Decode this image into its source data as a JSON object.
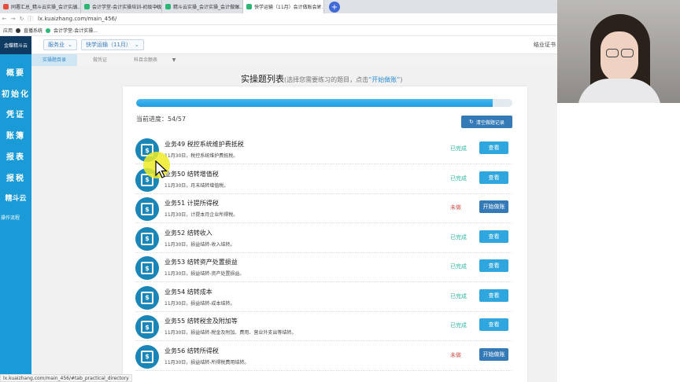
{
  "browser": {
    "tabs": [
      {
        "label": "同署汇总_精斗云实操_会计实战..."
      },
      {
        "label": "会计学堂-会计实操培训-初级中级..."
      },
      {
        "label": "精斗云实操_会计实操_会计做账..."
      },
      {
        "label": "快学运输（11月）会计做账会计..."
      }
    ],
    "new_tab": "+",
    "url": "lx.kuaizhang.com/main_456/",
    "bookmarks": [
      "应用",
      "直播系统",
      "会计学堂-会计实操..."
    ]
  },
  "app": {
    "logo": "金蝶精斗云",
    "service_select": "服务业",
    "company_select": "快学运输（11月）",
    "certificate": "结业证书"
  },
  "subnav": {
    "tabs": [
      "实操题目录",
      "做凭证",
      "科目余额表"
    ]
  },
  "sidebar": {
    "items": [
      "概要",
      "初始化",
      "凭证",
      "账簿",
      "报表",
      "报税",
      "精斗云",
      "操作流程"
    ]
  },
  "page": {
    "title": "实操题列表",
    "subtitle_prefix": "(选择您需要练习的题目，点击",
    "subtitle_highlight": "“开始做账”",
    "subtitle_suffix": ")",
    "progress_label": "当前进度：54/57",
    "progress_fraction": 0.947,
    "clear_button": "清空做题记录",
    "rows": [
      {
        "title": "业务49 税控系统维护费抵税",
        "desc": "11月30日，税控系统维护费抵税。",
        "status": "已完成",
        "status_type": "done",
        "button": "查看",
        "button_type": "view"
      },
      {
        "title": "业务50 结转增值税",
        "desc": "11月30日，月末结转增值税。",
        "status": "已完成",
        "status_type": "done",
        "button": "查看",
        "button_type": "view"
      },
      {
        "title": "业务51 计提所得税",
        "desc": "11月30日，计提本月企业所得税。",
        "status": "未做",
        "status_type": "todo",
        "button": "开始做账",
        "button_type": "start"
      },
      {
        "title": "业务52 结转收入",
        "desc": "11月30日，损益结转-收入结转。",
        "status": "已完成",
        "status_type": "done",
        "button": "查看",
        "button_type": "view"
      },
      {
        "title": "业务53 结转资产处置损益",
        "desc": "11月30日，损益结转-资产处置损益。",
        "status": "已完成",
        "status_type": "done",
        "button": "查看",
        "button_type": "view"
      },
      {
        "title": "业务54 结转成本",
        "desc": "11月30日，损益结转-成本结转。",
        "status": "已完成",
        "status_type": "done",
        "button": "查看",
        "button_type": "view"
      },
      {
        "title": "业务55 结转税金及附加等",
        "desc": "11月30日，损益结转-税金及附加、费用、营业外支出等结转。",
        "status": "已完成",
        "status_type": "done",
        "button": "查看",
        "button_type": "view"
      },
      {
        "title": "业务56 结转所得税",
        "desc": "11月30日，损益结转-所得税费用结转。",
        "status": "未做",
        "status_type": "todo",
        "button": "开始做账",
        "button_type": "start"
      }
    ]
  },
  "status_bar": "lx.kuaizhang.com/main_456/#tab_practical_directory",
  "colors": {
    "sidebar": "#1a9bd7",
    "done": "#2bb6a3",
    "todo": "#d9534f",
    "view_button": "#2fa7de",
    "start_button": "#337ab7"
  }
}
